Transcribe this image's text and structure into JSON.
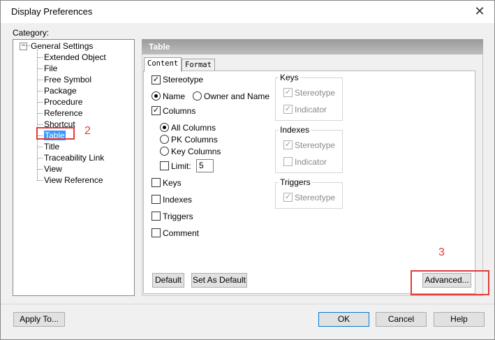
{
  "window": {
    "title": "Display Preferences",
    "close_glyph": "✕"
  },
  "category_label": "Category:",
  "tree": {
    "root_toggle": "−",
    "root": "General Settings",
    "items": [
      "Extended Object",
      "File",
      "Free Symbol",
      "Package",
      "Procedure",
      "Reference",
      "Shortcut",
      "Table",
      "Title",
      "Traceability Link",
      "View",
      "View Reference"
    ],
    "selected": "Table"
  },
  "panel": {
    "header": "Table",
    "tabs": [
      "Content",
      "Format"
    ],
    "content": {
      "stereotype": "Stereotype",
      "name": "Name",
      "owner_and_name": "Owner and Name",
      "columns": "Columns",
      "all_columns": "All Columns",
      "pk_columns": "PK Columns",
      "key_columns": "Key Columns",
      "limit_label": "Limit:",
      "limit_value": "5",
      "keys": "Keys",
      "indexes": "Indexes",
      "triggers": "Triggers",
      "comment": "Comment"
    },
    "groups": {
      "keys": {
        "title": "Keys",
        "items": [
          "Stereotype",
          "Indicator"
        ]
      },
      "indexes": {
        "title": "Indexes",
        "items": [
          "Stereotype",
          "Indicator"
        ]
      },
      "triggers": {
        "title": "Triggers",
        "items": [
          "Stereotype"
        ]
      }
    },
    "buttons": {
      "default": "Default",
      "set_as_default": "Set As Default",
      "advanced": "Advanced..."
    }
  },
  "footer": {
    "apply_to": "Apply To...",
    "ok": "OK",
    "cancel": "Cancel",
    "help": "Help"
  },
  "annotations": {
    "a2": "2",
    "a3": "3"
  },
  "colors": {
    "annotation_red": "#e23b3b",
    "selection_blue": "#3399ff"
  }
}
